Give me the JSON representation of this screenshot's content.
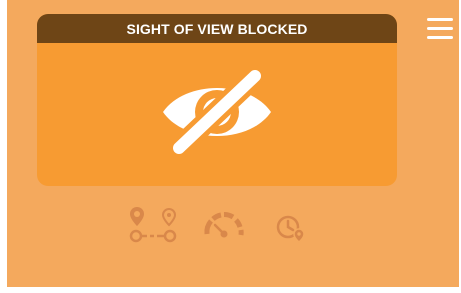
{
  "header": {
    "title": "SIGHT OF VIEW BLOCKED"
  },
  "colors": {
    "background": "#f4a95d",
    "card": "#f79b32",
    "header": "#6e4516",
    "icon_muted": "#d9884a",
    "white": "#ffffff"
  },
  "icons": {
    "menu": "hamburger-menu-icon",
    "main": "eye-slash-icon",
    "route": "route-pins-icon",
    "speed": "speedometer-icon",
    "time": "clock-location-icon"
  }
}
